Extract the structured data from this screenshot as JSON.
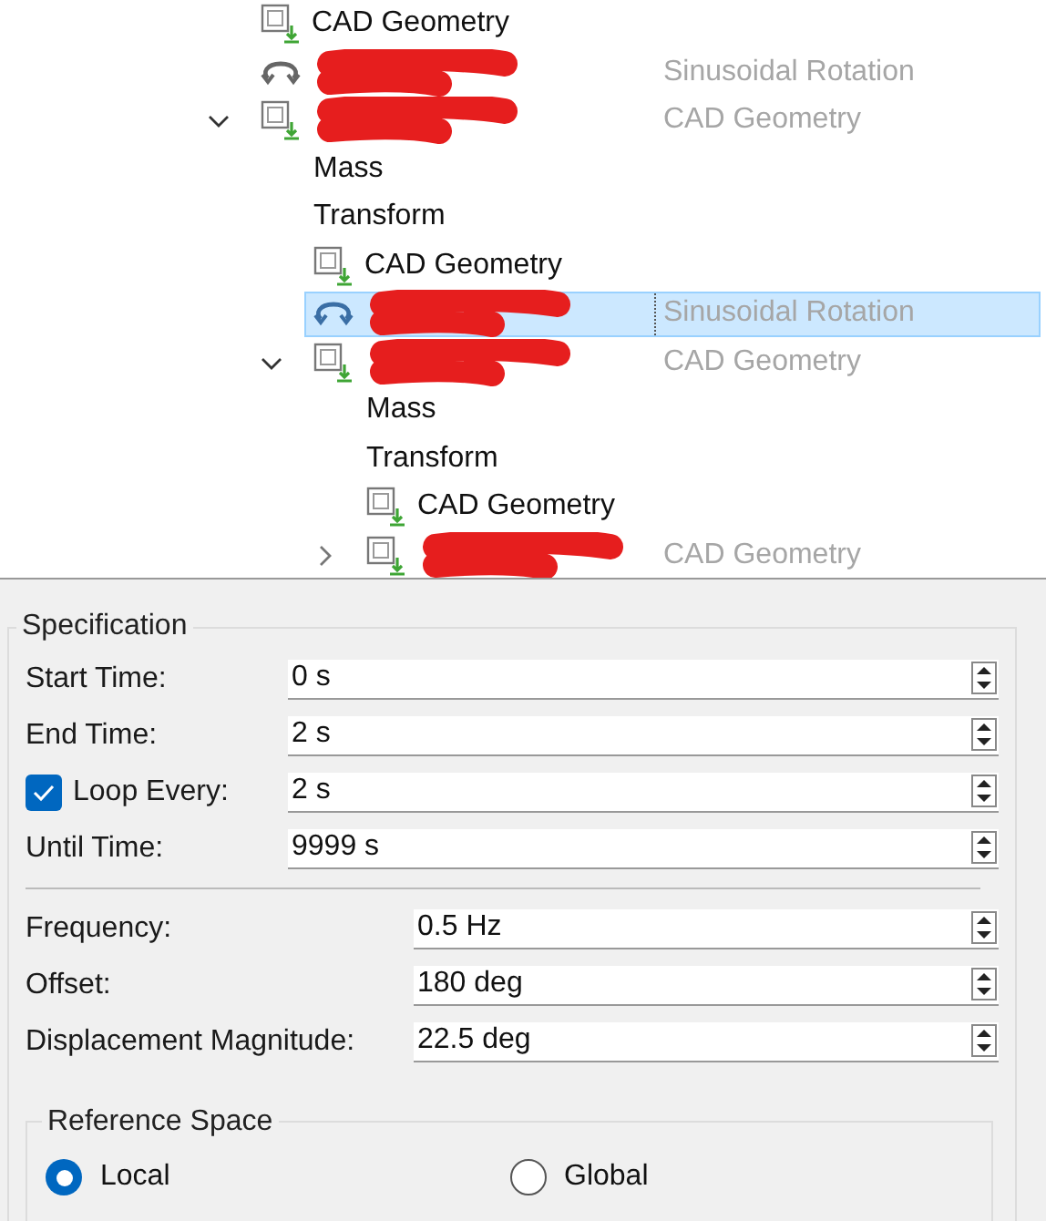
{
  "tree": {
    "rows": [
      {
        "kind": "geometry",
        "name": "CAD Geometry",
        "selected": false
      },
      {
        "kind": "rotation",
        "redacted": true,
        "type": "Sinusoidal Rotation",
        "selected": false
      },
      {
        "kind": "body",
        "redacted": true,
        "type": "CAD Geometry",
        "expanded": true,
        "selected": false,
        "children": [
          {
            "kind": "plain",
            "name": "Mass",
            "selected": false
          },
          {
            "kind": "plain",
            "name": "Transform",
            "selected": false
          },
          {
            "kind": "geometry",
            "name": "CAD Geometry",
            "selected": false
          },
          {
            "kind": "rotation",
            "redacted": true,
            "type": "Sinusoidal Rotation",
            "selected": true
          },
          {
            "kind": "body",
            "redacted": true,
            "type": "CAD Geometry",
            "expanded": true,
            "selected": false,
            "children": [
              {
                "kind": "plain",
                "name": "Mass",
                "selected": false
              },
              {
                "kind": "plain",
                "name": "Transform",
                "selected": false
              },
              {
                "kind": "geometry",
                "name": "CAD Geometry",
                "selected": false
              },
              {
                "kind": "body",
                "redacted": true,
                "type": "CAD Geometry",
                "expanded": false,
                "selected": false
              }
            ]
          }
        ]
      }
    ]
  },
  "specification": {
    "title": "Specification",
    "time_fields": [
      {
        "label": "Start Time:",
        "value": "0 s"
      },
      {
        "label": "End Time:",
        "value": "2 s"
      },
      {
        "label": "Loop Every:",
        "value": "2 s",
        "checkbox": true,
        "checked": true
      },
      {
        "label": "Until Time:",
        "value": "9999 s"
      }
    ],
    "motion_fields": [
      {
        "label": "Frequency:",
        "value": "0.5 Hz"
      },
      {
        "label": "Offset:",
        "value": "180 deg"
      },
      {
        "label": "Displacement Magnitude:",
        "value": "22.5 deg"
      }
    ],
    "reference_space": {
      "title": "Reference Space",
      "options": [
        {
          "label": "Local",
          "selected": true
        },
        {
          "label": "Global",
          "selected": false
        }
      ]
    }
  }
}
